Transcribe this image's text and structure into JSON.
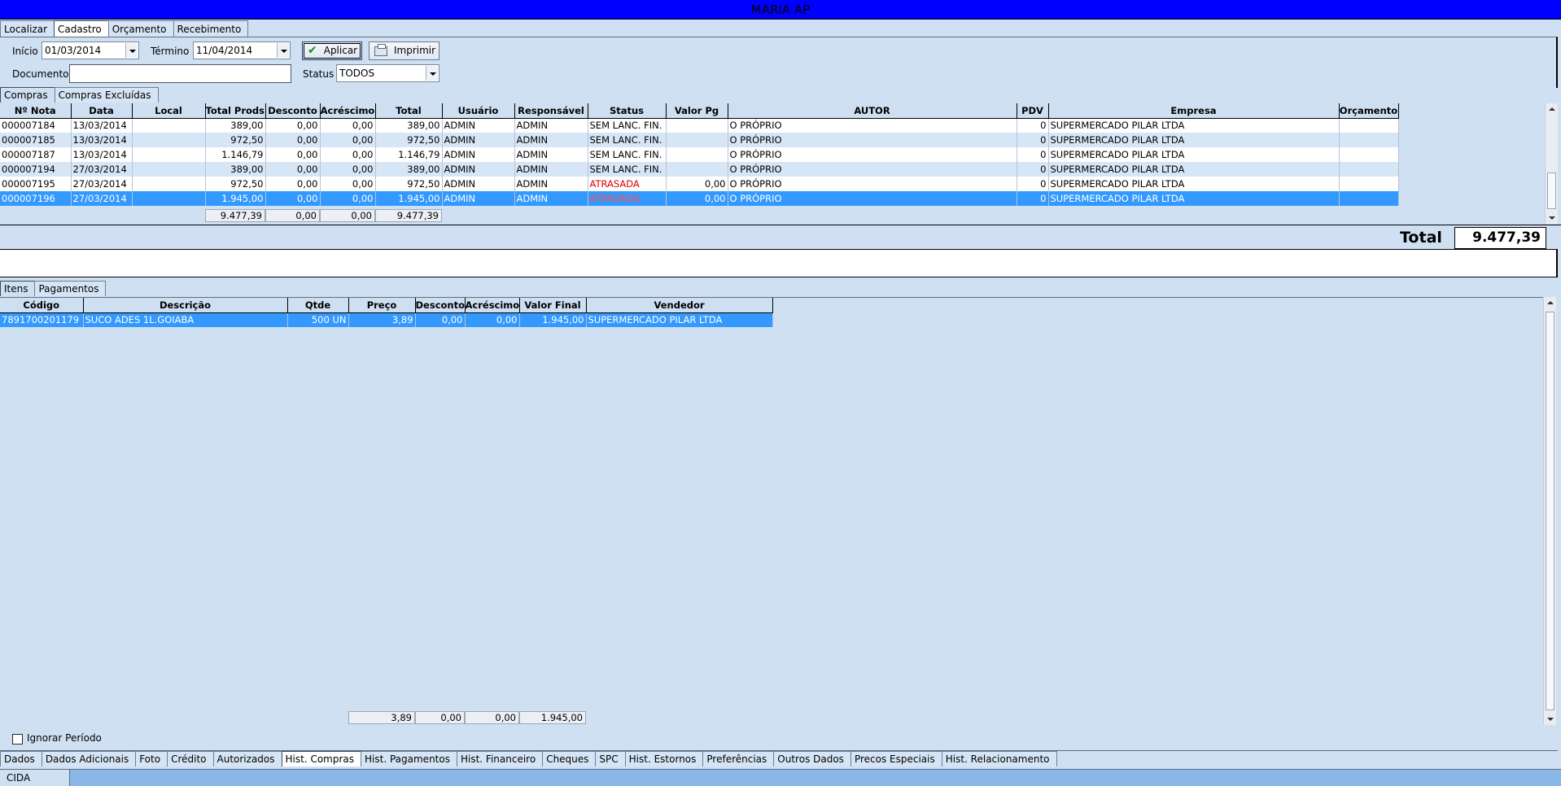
{
  "window": {
    "title": "MARIA AP"
  },
  "top_tabs": [
    "Localizar",
    "Cadastro",
    "Orçamento",
    "Recebimento"
  ],
  "filters": {
    "inicio_label": "Início",
    "inicio_value": "01/03/2014",
    "termino_label": "Término",
    "termino_value": "11/04/2014",
    "aplicar_label": "Aplicar",
    "imprimir_label": "Imprimir",
    "documento_label": "Documento",
    "documento_value": "",
    "status_label": "Status",
    "status_value": "TODOS"
  },
  "compras_tabs": [
    "Compras",
    "Compras Excluídas"
  ],
  "compras": {
    "headers": [
      "Nº Nota",
      "Data",
      "Local",
      "Total Prods.",
      "Desconto",
      "Acréscimo",
      "Total",
      "Usuário",
      "Responsável",
      "Status",
      "Valor Pg",
      "AUTOR",
      "PDV",
      "Empresa",
      "Orçamento"
    ],
    "rows": [
      [
        "000007184",
        "13/03/2014",
        "",
        "389,00",
        "0,00",
        "0,00",
        "389,00",
        "ADMIN",
        "ADMIN",
        "SEM LANC. FIN.",
        "",
        "O PRÓPRIO",
        "0",
        "SUPERMERCADO PILAR LTDA",
        ""
      ],
      [
        "000007185",
        "13/03/2014",
        "",
        "972,50",
        "0,00",
        "0,00",
        "972,50",
        "ADMIN",
        "ADMIN",
        "SEM LANC. FIN.",
        "",
        "O PRÓPRIO",
        "0",
        "SUPERMERCADO PILAR LTDA",
        ""
      ],
      [
        "000007187",
        "13/03/2014",
        "",
        "1.146,79",
        "0,00",
        "0,00",
        "1.146,79",
        "ADMIN",
        "ADMIN",
        "SEM LANC. FIN.",
        "",
        "O PRÓPRIO",
        "0",
        "SUPERMERCADO PILAR LTDA",
        ""
      ],
      [
        "000007194",
        "27/03/2014",
        "",
        "389,00",
        "0,00",
        "0,00",
        "389,00",
        "ADMIN",
        "ADMIN",
        "SEM LANC. FIN.",
        "",
        "O PRÓPRIO",
        "0",
        "SUPERMERCADO PILAR LTDA",
        ""
      ],
      [
        "000007195",
        "27/03/2014",
        "",
        "972,50",
        "0,00",
        "0,00",
        "972,50",
        "ADMIN",
        "ADMIN",
        "ATRASADA",
        "0,00",
        "O PRÓPRIO",
        "0",
        "SUPERMERCADO PILAR LTDA",
        ""
      ],
      [
        "000007196",
        "27/03/2014",
        "",
        "1.945,00",
        "0,00",
        "0,00",
        "1.945,00",
        "ADMIN",
        "ADMIN",
        "ATRASADA",
        "0,00",
        "O PRÓPRIO",
        "0",
        "SUPERMERCADO PILAR LTDA",
        ""
      ]
    ],
    "footer": [
      "9.477,39",
      "0,00",
      "0,00",
      "9.477,39"
    ],
    "total_label": "Total",
    "total_value": "9.477,39"
  },
  "itens_tabs": [
    "Itens",
    "Pagamentos"
  ],
  "itens": {
    "headers": [
      "Código",
      "Descrição",
      "Qtde",
      "Preço",
      "Desconto",
      "Acréscimo",
      "Valor Final",
      "Vendedor"
    ],
    "rows": [
      [
        "7891700201179",
        "SUCO ADES 1L.GOIABA",
        "500 UN",
        "3,89",
        "0,00",
        "0,00",
        "1.945,00",
        "SUPERMERCADO PILAR LTDA"
      ]
    ],
    "footer": [
      "3,89",
      "0,00",
      "0,00",
      "1.945,00"
    ]
  },
  "ignorar_periodo_label": "Ignorar Período",
  "bottom_tabs": [
    "Dados",
    "Dados Adicionais",
    "Foto",
    "Crédito",
    "Autorizados",
    "Hist. Compras",
    "Hist. Pagamentos",
    "Hist. Financeiro",
    "Cheques",
    "SPC",
    "Hist. Estornos",
    "Preferências",
    "Outros Dados",
    "Precos Especiais",
    "Hist. Relacionamento"
  ],
  "status_bar": {
    "user": "CIDA"
  }
}
